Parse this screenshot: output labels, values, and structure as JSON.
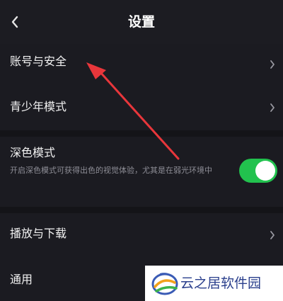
{
  "header": {
    "title": "设置"
  },
  "settings": {
    "account_security": "账号与安全",
    "teen_mode": "青少年模式",
    "dark_mode": {
      "label": "深色模式",
      "description": "开启深色模式可获得出色的视觉体验，尤其是在弱光环境中",
      "enabled": true
    },
    "play_download": "播放与下载",
    "general": "通用"
  },
  "watermark": {
    "text": "云之居软件园"
  },
  "icons": {
    "back": "chevron-left-icon",
    "row_arrow": "chevron-right-icon",
    "annotation": "red-arrow-annotation"
  },
  "colors": {
    "background": "#1b1b21",
    "toggle_on": "#22c24e",
    "annotation_arrow": "#e8363b",
    "watermark_text": "#2a3f8c"
  }
}
